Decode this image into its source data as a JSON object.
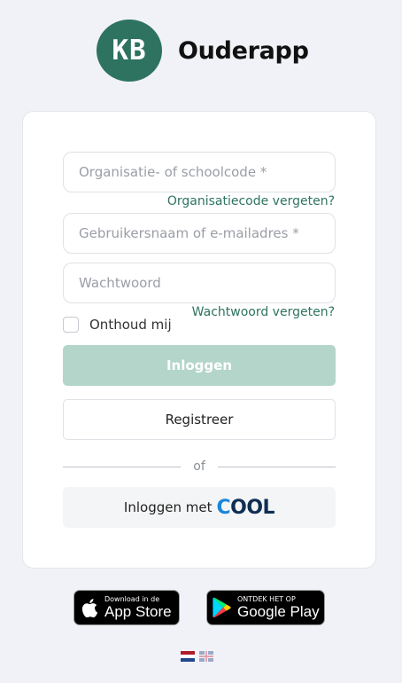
{
  "header": {
    "logo_text": "KB",
    "app_title": "Ouderapp"
  },
  "form": {
    "org_code_placeholder": "Organisatie- of schoolcode *",
    "forgot_org_code": "Organisatiecode vergeten?",
    "username_placeholder": "Gebruikersnaam of e-mailadres *",
    "password_placeholder": "Wachtwoord",
    "forgot_password": "Wachtwoord vergeten?",
    "remember_me": "Onthoud mij",
    "remember_checked": false,
    "login_button": "Inloggen",
    "register_button": "Registreer",
    "divider_text": "of",
    "cool_login_prefix": "Inloggen met",
    "cool_logo_text": "COOL"
  },
  "stores": {
    "apple": {
      "small": "Download in de",
      "big": "App Store"
    },
    "google": {
      "small": "ONTDEK HET OP",
      "big": "Google Play"
    }
  },
  "languages": [
    {
      "code": "nl",
      "icon": "flag-nl-icon"
    },
    {
      "code": "en",
      "icon": "flag-en-icon"
    }
  ],
  "colors": {
    "brand": "#2e7360",
    "login_button_bg": "#b4d5ca",
    "background": "#f1f2f7",
    "cool_blue": "#1b86d8",
    "cool_navy": "#0f2f52"
  }
}
